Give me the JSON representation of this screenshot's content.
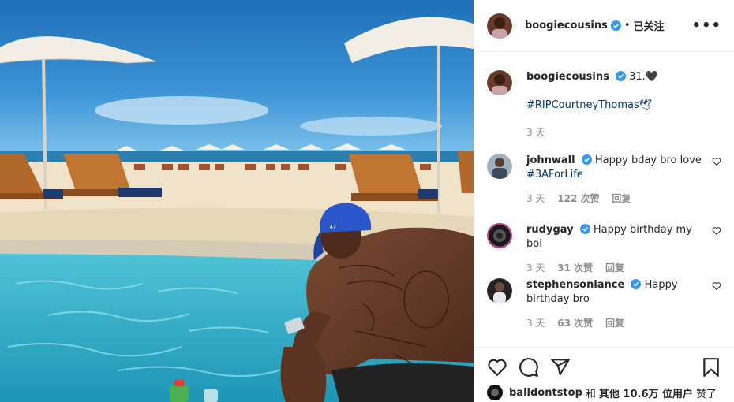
{
  "post": {
    "author": "boogiecousins",
    "follow_status": "已关注",
    "separator": "•",
    "more_label": "•••",
    "caption": "31.🖤",
    "hashtag": "#RIPCourtneyThomas🕊",
    "time": "3 天"
  },
  "comments": [
    {
      "user": "johnwall",
      "text": "Happy bday bro love",
      "hashtag": "#3AForLife",
      "time": "3 天",
      "likes": "122 次赞",
      "reply": "回复"
    },
    {
      "user": "rudygay",
      "text": "Happy birthday my boi",
      "time": "3 天",
      "likes": "31 次赞",
      "reply": "回复"
    },
    {
      "user": "stephensonlance",
      "text": "Happy birthday bro",
      "time": "3 天",
      "likes": "63 次赞",
      "reply": "回复"
    }
  ],
  "likes_line": {
    "user": "balldontstop",
    "conj": "和",
    "others": "其他 10.6万 位用户",
    "suffix": "赞了"
  },
  "icons": [
    "verified-badge-icon",
    "more-options-icon",
    "heart-icon",
    "comment-icon",
    "share-icon",
    "bookmark-icon"
  ],
  "colors": {
    "verified": "#3897f0",
    "hashtag": "#00376b",
    "muted": "#8e8e8e",
    "border": "#efefef"
  }
}
